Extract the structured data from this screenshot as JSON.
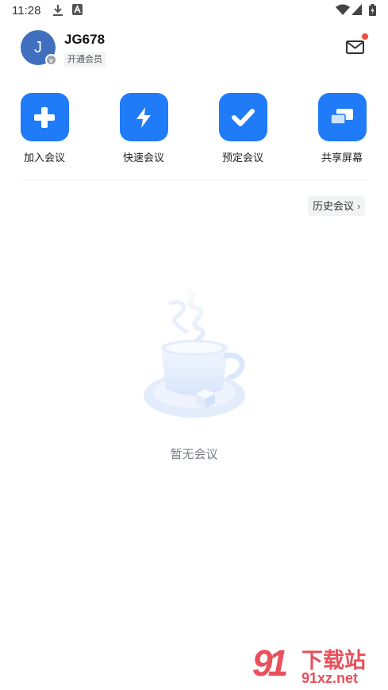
{
  "status_bar": {
    "time": "11:28",
    "icons": [
      "download-icon",
      "font-icon",
      "wifi-icon",
      "signal-icon",
      "battery-icon"
    ]
  },
  "header": {
    "avatar_letter": "J",
    "avatar_badge": "v",
    "username": "JG678",
    "member_tag": "开通会员",
    "mail_icon": "mail-icon",
    "has_notification": true
  },
  "actions": [
    {
      "label": "加入会议",
      "icon": "plus-icon"
    },
    {
      "label": "快速会议",
      "icon": "lightning-icon"
    },
    {
      "label": "预定会议",
      "icon": "check-icon"
    },
    {
      "label": "共享屏幕",
      "icon": "share-screen-icon"
    }
  ],
  "history_button": {
    "label": "历史会议",
    "chevron": "›"
  },
  "empty_state": {
    "icon": "coffee-cup-icon",
    "text": "暂无会议"
  },
  "watermark": {
    "logo": "91",
    "title": "下载站",
    "site": "91xz.net"
  },
  "colors": {
    "accent": "#1f7bf7",
    "avatar": "#3f6fbe",
    "notification": "#ef4f3a",
    "watermark": "#e8505b"
  }
}
